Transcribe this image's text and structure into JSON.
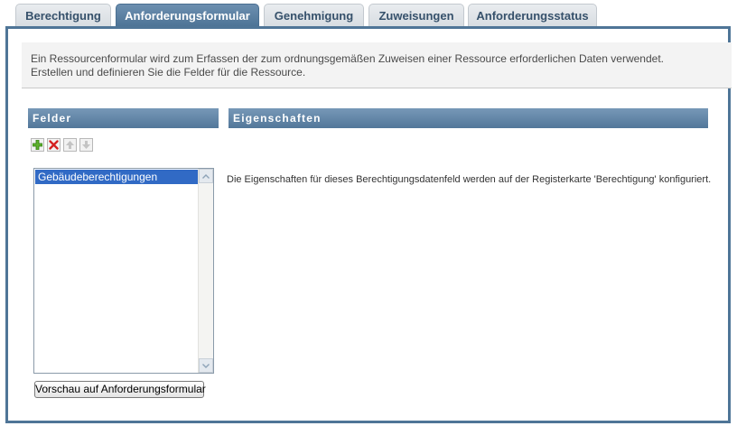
{
  "tabs": [
    {
      "label": "Berechtigung",
      "active": false
    },
    {
      "label": "Anforderungsformular",
      "active": true
    },
    {
      "label": "Genehmigung",
      "active": false
    },
    {
      "label": "Zuweisungen",
      "active": false
    },
    {
      "label": "Anforderungsstatus",
      "active": false
    }
  ],
  "description": {
    "line1": "Ein Ressourcenformular wird zum Erfassen der zum ordnungsgemäßen Zuweisen einer Ressource erforderlichen Daten verwendet.",
    "line2": "Erstellen und definieren Sie die Felder für die Ressource."
  },
  "fields": {
    "header": "Felder",
    "toolbar": {
      "icons": [
        "add-icon",
        "delete-icon",
        "move-up-icon",
        "move-down-icon"
      ]
    },
    "items": [
      {
        "label": "Gebäudeberechtigungen",
        "selected": true
      }
    ],
    "preview_button": "Vorschau auf Anforderungsformular"
  },
  "properties": {
    "header": "Eigenschaften",
    "message": "Die Eigenschaften für dieses Berechtigungsdatenfeld werden auf der Registerkarte 'Berechtigung' konfiguriert."
  },
  "colors": {
    "accent": "#4f7597",
    "selection": "#316ac5",
    "add_icon": "#4a9a1e",
    "delete_icon": "#d42020"
  }
}
